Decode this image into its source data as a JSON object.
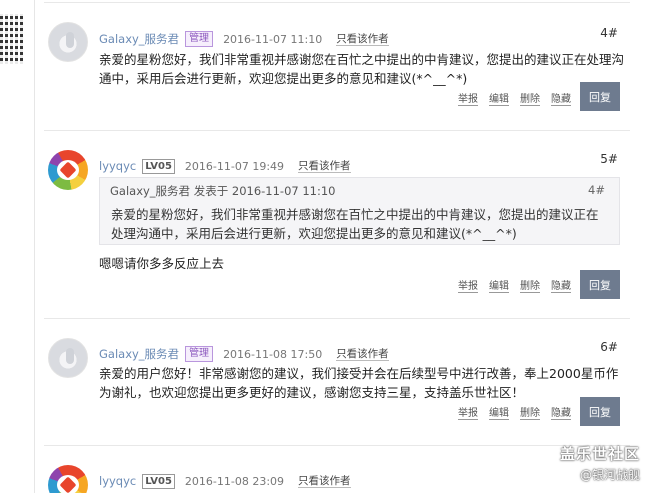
{
  "posts": [
    {
      "username": "Galaxy_服务君",
      "badge": "管理",
      "date": "2016-11-07 11:10",
      "author_only": "只看该作者",
      "floor": "4#",
      "content": "亲爱的星粉您好，我们非常重视并感谢您在百忙之中提出的中肯建议，您提出的建议正在处理沟通中，采用后会进行更新，欢迎您提出更多的意见和建议(*^__^*)"
    },
    {
      "username": "lyyqyc",
      "badge": "LV05",
      "date": "2016-11-07 19:49",
      "author_only": "只看该作者",
      "floor": "5#",
      "quote": {
        "head": "Galaxy_服务君 发表于 2016-11-07 11:10",
        "floor": "4#",
        "body": "亲爱的星粉您好，我们非常重视并感谢您在百忙之中提出的中肯建议，您提出的建议正在处理沟通中，采用后会进行更新，欢迎您提出更多的意见和建议(*^__^*)"
      },
      "content": "嗯嗯请你多多反应上去"
    },
    {
      "username": "Galaxy_服务君",
      "badge": "管理",
      "date": "2016-11-08 17:50",
      "author_only": "只看该作者",
      "floor": "6#",
      "content": "亲爱的用户您好！非常感谢您的建议，我们接受并会在后续型号中进行改善，奉上2000星币作为谢礼，也欢迎您提出更多更好的建议，感谢您支持三星，支持盖乐世社区！"
    },
    {
      "username": "lyyqyc",
      "badge": "LV05",
      "date": "2016-11-08 23:09",
      "author_only": "只看该作者"
    }
  ],
  "actions": {
    "report": "举报",
    "edit": "编辑",
    "delete": "删除",
    "hide": "隐藏",
    "reply": "回复"
  },
  "watermark": {
    "line1": "盖乐世社区",
    "line2": "@银河战舰"
  },
  "colors": {
    "username": "#6b8bb5",
    "reply_button": "#6e7b8f",
    "admin_badge": "#8e5bbf"
  }
}
